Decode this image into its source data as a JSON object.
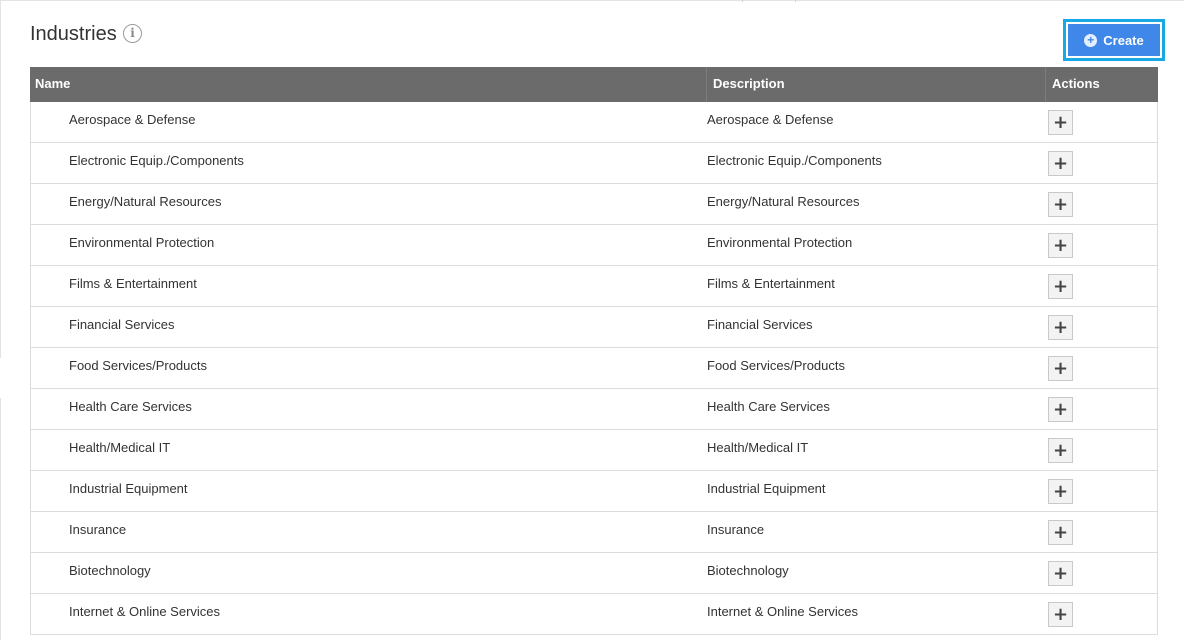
{
  "page": {
    "title": "Industries",
    "info_icon": "info-icon",
    "create_label": "Create",
    "create_icon": "plus-circle-icon"
  },
  "colors": {
    "header_bg": "#6b6b6b",
    "create_button": "#3f87e8",
    "focus_ring": "#1aa7e6"
  },
  "table": {
    "headers": {
      "name": "Name",
      "description": "Description",
      "actions": "Actions"
    },
    "action_icon": "plus-icon",
    "rows": [
      {
        "name": "Aerospace & Defense",
        "description": "Aerospace & Defense"
      },
      {
        "name": "Electronic Equip./Components",
        "description": "Electronic Equip./Components"
      },
      {
        "name": "Energy/Natural Resources",
        "description": "Energy/Natural Resources"
      },
      {
        "name": "Environmental Protection",
        "description": "Environmental Protection"
      },
      {
        "name": "Films & Entertainment",
        "description": "Films & Entertainment"
      },
      {
        "name": "Financial Services",
        "description": "Financial Services"
      },
      {
        "name": "Food Services/Products",
        "description": "Food Services/Products"
      },
      {
        "name": "Health Care Services",
        "description": "Health Care Services"
      },
      {
        "name": "Health/Medical IT",
        "description": "Health/Medical IT"
      },
      {
        "name": "Industrial Equipment",
        "description": "Industrial Equipment"
      },
      {
        "name": "Insurance",
        "description": "Insurance"
      },
      {
        "name": "Biotechnology",
        "description": "Biotechnology"
      },
      {
        "name": "Internet & Online Services",
        "description": "Internet & Online Services"
      }
    ]
  }
}
